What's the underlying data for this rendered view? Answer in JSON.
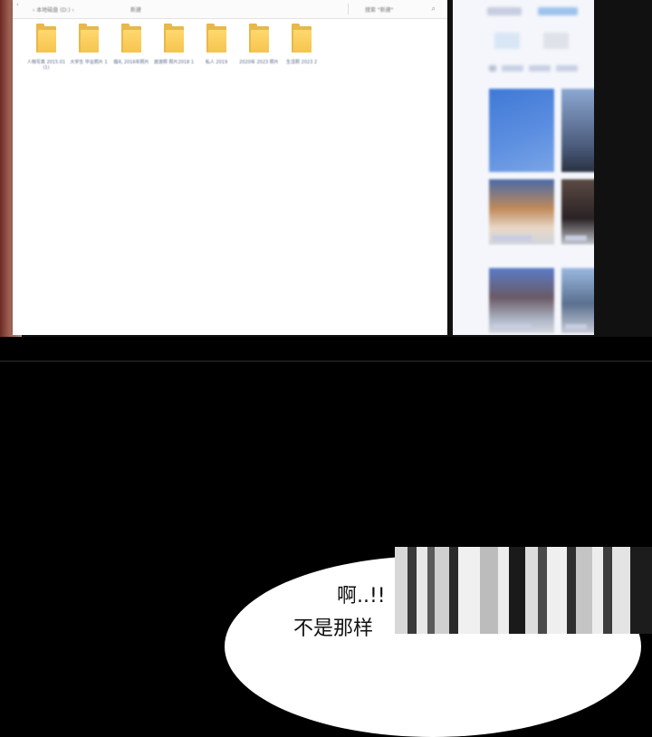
{
  "explorer": {
    "breadcrumb": "› 本地磁盘 (D:) ›",
    "folder_title": "新建",
    "search_placeholder": "搜索 \"新建\"",
    "folders": [
      {
        "label": "人物写真 2015.01 (1)"
      },
      {
        "label": "大学生 毕业照片 1"
      },
      {
        "label": "婚礼 2016年照片"
      },
      {
        "label": "旅游照 照片2018 1"
      },
      {
        "label": "私人 2019"
      },
      {
        "label": "2020年 2023 照片"
      },
      {
        "label": "生活照 2023 2"
      }
    ]
  },
  "gallery": {
    "top_tabs": [
      "",
      ""
    ],
    "filter_chips": [
      "",
      ""
    ],
    "section_labels": [
      "",
      "",
      "",
      ""
    ],
    "thumb_colors": [
      "#4a7fd0",
      "#8ea6c8",
      "#c89a6a",
      "#6a5a52",
      "#7a8ab0",
      "#b0c2d8"
    ]
  },
  "speech": {
    "line1": "啊..!!",
    "line2": "不是那样"
  },
  "colors": {
    "background": "#000000",
    "folder_yellow": "#f5c44f",
    "bubble": "#ffffff"
  }
}
